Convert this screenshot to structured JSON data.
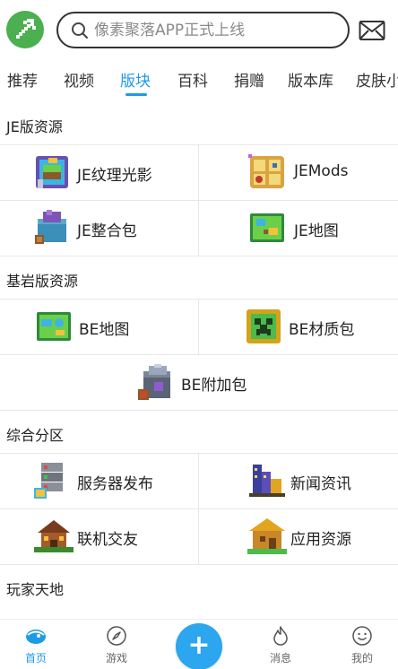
{
  "header": {
    "search_placeholder": "像素聚落APP正式上线"
  },
  "tabs": [
    {
      "label": "推荐",
      "active": false
    },
    {
      "label": "视频",
      "active": false
    },
    {
      "label": "版块",
      "active": true
    },
    {
      "label": "百科",
      "active": false
    },
    {
      "label": "捐赠",
      "active": false
    },
    {
      "label": "版本库",
      "active": false
    },
    {
      "label": "皮肤小",
      "active": false
    }
  ],
  "sections": [
    {
      "title": "JE版资源",
      "items": [
        {
          "label": "JE纹理光影",
          "icon": "texture-shader-icon"
        },
        {
          "label": "JEMods",
          "icon": "mods-icon"
        },
        {
          "label": "JE整合包",
          "icon": "modpack-icon"
        },
        {
          "label": "JE地图",
          "icon": "map-icon"
        }
      ]
    },
    {
      "title": "基岩版资源",
      "items": [
        {
          "label": "BE地图",
          "icon": "map-icon"
        },
        {
          "label": "BE材质包",
          "icon": "creeper-icon"
        },
        {
          "label": "BE附加包",
          "icon": "addon-icon"
        }
      ]
    },
    {
      "title": "综合分区",
      "items": [
        {
          "label": "服务器发布",
          "icon": "server-icon"
        },
        {
          "label": "新闻资讯",
          "icon": "city-icon"
        },
        {
          "label": "联机交友",
          "icon": "house-icon"
        },
        {
          "label": "应用资源",
          "icon": "village-icon"
        }
      ]
    },
    {
      "title": "玩家天地",
      "items": []
    }
  ],
  "bottom_nav": [
    {
      "label": "首页",
      "icon": "home-icon",
      "active": true
    },
    {
      "label": "游戏",
      "icon": "compass-icon",
      "active": false
    },
    {
      "label": "消息",
      "icon": "flame-icon",
      "active": false
    },
    {
      "label": "我的",
      "icon": "smile-icon",
      "active": false
    }
  ],
  "plus_button": {
    "label": "+"
  },
  "colors": {
    "accent": "#1e9be6",
    "logo_bg": "#4caf50",
    "divider": "#e8e8e8"
  }
}
